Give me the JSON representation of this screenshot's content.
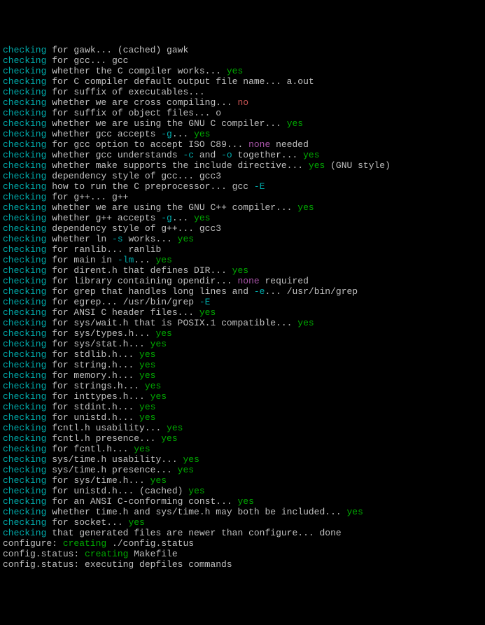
{
  "lines": [
    {
      "segments": [
        {
          "t": "checking",
          "c": "checking"
        },
        {
          "t": " for gawk... (cached) gawk",
          "c": "plain"
        }
      ]
    },
    {
      "segments": [
        {
          "t": "checking",
          "c": "checking"
        },
        {
          "t": " for gcc... gcc",
          "c": "plain"
        }
      ]
    },
    {
      "segments": [
        {
          "t": "checking",
          "c": "checking"
        },
        {
          "t": " whether the C compiler works... ",
          "c": "plain"
        },
        {
          "t": "yes",
          "c": "yes"
        }
      ]
    },
    {
      "segments": [
        {
          "t": "checking",
          "c": "checking"
        },
        {
          "t": " for C compiler default output file name... a.out",
          "c": "plain"
        }
      ]
    },
    {
      "segments": [
        {
          "t": "checking",
          "c": "checking"
        },
        {
          "t": " for suffix of executables...",
          "c": "plain"
        }
      ]
    },
    {
      "segments": [
        {
          "t": "checking",
          "c": "checking"
        },
        {
          "t": " whether we are cross compiling... ",
          "c": "plain"
        },
        {
          "t": "no",
          "c": "no"
        }
      ]
    },
    {
      "segments": [
        {
          "t": "checking",
          "c": "checking"
        },
        {
          "t": " for suffix of object files... o",
          "c": "plain"
        }
      ]
    },
    {
      "segments": [
        {
          "t": "checking",
          "c": "checking"
        },
        {
          "t": " whether we are using the GNU C compiler... ",
          "c": "plain"
        },
        {
          "t": "yes",
          "c": "yes"
        }
      ]
    },
    {
      "segments": [
        {
          "t": "checking",
          "c": "checking"
        },
        {
          "t": " whether gcc accepts ",
          "c": "plain"
        },
        {
          "t": "-g",
          "c": "flag"
        },
        {
          "t": "... ",
          "c": "plain"
        },
        {
          "t": "yes",
          "c": "yes"
        }
      ]
    },
    {
      "segments": [
        {
          "t": "checking",
          "c": "checking"
        },
        {
          "t": " for gcc option to accept ISO C89... ",
          "c": "plain"
        },
        {
          "t": "none",
          "c": "none"
        },
        {
          "t": " needed",
          "c": "plain"
        }
      ]
    },
    {
      "segments": [
        {
          "t": "checking",
          "c": "checking"
        },
        {
          "t": " whether gcc understands ",
          "c": "plain"
        },
        {
          "t": "-c",
          "c": "flag"
        },
        {
          "t": " and ",
          "c": "plain"
        },
        {
          "t": "-o",
          "c": "flag"
        },
        {
          "t": " together... ",
          "c": "plain"
        },
        {
          "t": "yes",
          "c": "yes"
        }
      ]
    },
    {
      "segments": [
        {
          "t": "checking",
          "c": "checking"
        },
        {
          "t": " whether make supports the include directive... ",
          "c": "plain"
        },
        {
          "t": "yes",
          "c": "yes"
        },
        {
          "t": " (GNU style)",
          "c": "plain"
        }
      ]
    },
    {
      "segments": [
        {
          "t": "checking",
          "c": "checking"
        },
        {
          "t": " dependency style of gcc... gcc3",
          "c": "plain"
        }
      ]
    },
    {
      "segments": [
        {
          "t": "checking",
          "c": "checking"
        },
        {
          "t": " how to run the C preprocessor... gcc ",
          "c": "plain"
        },
        {
          "t": "-E",
          "c": "flag"
        }
      ]
    },
    {
      "segments": [
        {
          "t": "checking",
          "c": "checking"
        },
        {
          "t": " for g++... g++",
          "c": "plain"
        }
      ]
    },
    {
      "segments": [
        {
          "t": "checking",
          "c": "checking"
        },
        {
          "t": " whether we are using the GNU C++ compiler... ",
          "c": "plain"
        },
        {
          "t": "yes",
          "c": "yes"
        }
      ]
    },
    {
      "segments": [
        {
          "t": "checking",
          "c": "checking"
        },
        {
          "t": " whether g++ accepts ",
          "c": "plain"
        },
        {
          "t": "-g",
          "c": "flag"
        },
        {
          "t": "... ",
          "c": "plain"
        },
        {
          "t": "yes",
          "c": "yes"
        }
      ]
    },
    {
      "segments": [
        {
          "t": "checking",
          "c": "checking"
        },
        {
          "t": " dependency style of g++... gcc3",
          "c": "plain"
        }
      ]
    },
    {
      "segments": [
        {
          "t": "checking",
          "c": "checking"
        },
        {
          "t": " whether ln ",
          "c": "plain"
        },
        {
          "t": "-s",
          "c": "flag"
        },
        {
          "t": " works... ",
          "c": "plain"
        },
        {
          "t": "yes",
          "c": "yes"
        }
      ]
    },
    {
      "segments": [
        {
          "t": "checking",
          "c": "checking"
        },
        {
          "t": " for ranlib... ranlib",
          "c": "plain"
        }
      ]
    },
    {
      "segments": [
        {
          "t": "checking",
          "c": "checking"
        },
        {
          "t": " for main in ",
          "c": "plain"
        },
        {
          "t": "-lm",
          "c": "flag"
        },
        {
          "t": "... ",
          "c": "plain"
        },
        {
          "t": "yes",
          "c": "yes"
        }
      ]
    },
    {
      "segments": [
        {
          "t": "checking",
          "c": "checking"
        },
        {
          "t": " for dirent.h that defines DIR... ",
          "c": "plain"
        },
        {
          "t": "yes",
          "c": "yes"
        }
      ]
    },
    {
      "segments": [
        {
          "t": "checking",
          "c": "checking"
        },
        {
          "t": " for library containing opendir... ",
          "c": "plain"
        },
        {
          "t": "none",
          "c": "none"
        },
        {
          "t": " required",
          "c": "plain"
        }
      ]
    },
    {
      "segments": [
        {
          "t": "checking",
          "c": "checking"
        },
        {
          "t": " for grep that handles long lines and ",
          "c": "plain"
        },
        {
          "t": "-e",
          "c": "flag"
        },
        {
          "t": "... /usr/bin/grep",
          "c": "plain"
        }
      ]
    },
    {
      "segments": [
        {
          "t": "checking",
          "c": "checking"
        },
        {
          "t": " for egrep... /usr/bin/grep ",
          "c": "plain"
        },
        {
          "t": "-E",
          "c": "flag"
        }
      ]
    },
    {
      "segments": [
        {
          "t": "checking",
          "c": "checking"
        },
        {
          "t": " for ANSI C header files... ",
          "c": "plain"
        },
        {
          "t": "yes",
          "c": "yes"
        }
      ]
    },
    {
      "segments": [
        {
          "t": "checking",
          "c": "checking"
        },
        {
          "t": " for sys/wait.h that is POSIX.1 compatible... ",
          "c": "plain"
        },
        {
          "t": "yes",
          "c": "yes"
        }
      ]
    },
    {
      "segments": [
        {
          "t": "checking",
          "c": "checking"
        },
        {
          "t": " for sys/types.h... ",
          "c": "plain"
        },
        {
          "t": "yes",
          "c": "yes"
        }
      ]
    },
    {
      "segments": [
        {
          "t": "checking",
          "c": "checking"
        },
        {
          "t": " for sys/stat.h... ",
          "c": "plain"
        },
        {
          "t": "yes",
          "c": "yes"
        }
      ]
    },
    {
      "segments": [
        {
          "t": "checking",
          "c": "checking"
        },
        {
          "t": " for stdlib.h... ",
          "c": "plain"
        },
        {
          "t": "yes",
          "c": "yes"
        }
      ]
    },
    {
      "segments": [
        {
          "t": "checking",
          "c": "checking"
        },
        {
          "t": " for string.h... ",
          "c": "plain"
        },
        {
          "t": "yes",
          "c": "yes"
        }
      ]
    },
    {
      "segments": [
        {
          "t": "checking",
          "c": "checking"
        },
        {
          "t": " for memory.h... ",
          "c": "plain"
        },
        {
          "t": "yes",
          "c": "yes"
        }
      ]
    },
    {
      "segments": [
        {
          "t": "checking",
          "c": "checking"
        },
        {
          "t": " for strings.h... ",
          "c": "plain"
        },
        {
          "t": "yes",
          "c": "yes"
        }
      ]
    },
    {
      "segments": [
        {
          "t": "checking",
          "c": "checking"
        },
        {
          "t": " for inttypes.h... ",
          "c": "plain"
        },
        {
          "t": "yes",
          "c": "yes"
        }
      ]
    },
    {
      "segments": [
        {
          "t": "checking",
          "c": "checking"
        },
        {
          "t": " for stdint.h... ",
          "c": "plain"
        },
        {
          "t": "yes",
          "c": "yes"
        }
      ]
    },
    {
      "segments": [
        {
          "t": "checking",
          "c": "checking"
        },
        {
          "t": " for unistd.h... ",
          "c": "plain"
        },
        {
          "t": "yes",
          "c": "yes"
        }
      ]
    },
    {
      "segments": [
        {
          "t": "checking",
          "c": "checking"
        },
        {
          "t": " fcntl.h usability... ",
          "c": "plain"
        },
        {
          "t": "yes",
          "c": "yes"
        }
      ]
    },
    {
      "segments": [
        {
          "t": "checking",
          "c": "checking"
        },
        {
          "t": " fcntl.h presence... ",
          "c": "plain"
        },
        {
          "t": "yes",
          "c": "yes"
        }
      ]
    },
    {
      "segments": [
        {
          "t": "checking",
          "c": "checking"
        },
        {
          "t": " for fcntl.h... ",
          "c": "plain"
        },
        {
          "t": "yes",
          "c": "yes"
        }
      ]
    },
    {
      "segments": [
        {
          "t": "checking",
          "c": "checking"
        },
        {
          "t": " sys/time.h usability... ",
          "c": "plain"
        },
        {
          "t": "yes",
          "c": "yes"
        }
      ]
    },
    {
      "segments": [
        {
          "t": "checking",
          "c": "checking"
        },
        {
          "t": " sys/time.h presence... ",
          "c": "plain"
        },
        {
          "t": "yes",
          "c": "yes"
        }
      ]
    },
    {
      "segments": [
        {
          "t": "checking",
          "c": "checking"
        },
        {
          "t": " for sys/time.h... ",
          "c": "plain"
        },
        {
          "t": "yes",
          "c": "yes"
        }
      ]
    },
    {
      "segments": [
        {
          "t": "checking",
          "c": "checking"
        },
        {
          "t": " for unistd.h... (cached) ",
          "c": "plain"
        },
        {
          "t": "yes",
          "c": "yes"
        }
      ]
    },
    {
      "segments": [
        {
          "t": "checking",
          "c": "checking"
        },
        {
          "t": " for an ANSI C-conforming const... ",
          "c": "plain"
        },
        {
          "t": "yes",
          "c": "yes"
        }
      ]
    },
    {
      "segments": [
        {
          "t": "checking",
          "c": "checking"
        },
        {
          "t": " whether time.h and sys/time.h may both be included... ",
          "c": "plain"
        },
        {
          "t": "yes",
          "c": "yes"
        }
      ]
    },
    {
      "segments": [
        {
          "t": "checking",
          "c": "checking"
        },
        {
          "t": " for socket... ",
          "c": "plain"
        },
        {
          "t": "yes",
          "c": "yes"
        }
      ]
    },
    {
      "segments": [
        {
          "t": "checking",
          "c": "checking"
        },
        {
          "t": " that generated files are newer than configure... done",
          "c": "plain"
        }
      ]
    },
    {
      "segments": [
        {
          "t": "configure: ",
          "c": "plain"
        },
        {
          "t": "creating",
          "c": "creating"
        },
        {
          "t": " ./config.status",
          "c": "plain"
        }
      ]
    },
    {
      "segments": [
        {
          "t": "config.status: ",
          "c": "plain"
        },
        {
          "t": "creating",
          "c": "creating"
        },
        {
          "t": " Makefile",
          "c": "plain"
        }
      ]
    },
    {
      "segments": [
        {
          "t": "config.status: executing depfiles commands",
          "c": "plain"
        }
      ]
    }
  ]
}
